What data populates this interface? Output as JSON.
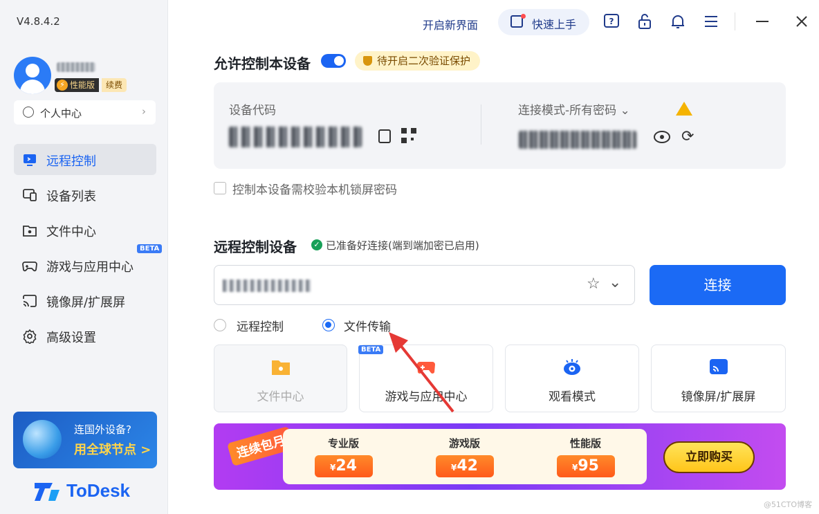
{
  "app": {
    "version": "V4.8.4.2",
    "brand": "ToDesk"
  },
  "user": {
    "tier_badge": "性能版",
    "renew_badge": "续费",
    "personal_center": "个人中心"
  },
  "sidebar": {
    "items": [
      {
        "label": "远程控制",
        "icon": "monitor-icon",
        "active": true
      },
      {
        "label": "设备列表",
        "icon": "devices-icon"
      },
      {
        "label": "文件中心",
        "icon": "folder-icon"
      },
      {
        "label": "游戏与应用中心",
        "icon": "gamepad-icon",
        "badge": "BETA"
      },
      {
        "label": "镜像屏/扩展屏",
        "icon": "cast-icon"
      },
      {
        "label": "高级设置",
        "icon": "gear-icon"
      }
    ],
    "promo": {
      "line1": "连国外设备?",
      "line2": "用全球节点 >"
    }
  },
  "topbar": {
    "new_ui": "开启新界面",
    "quick_start": "快速上手"
  },
  "allow": {
    "title": "允许控制本设备",
    "enabled": true,
    "warning": "待开启二次验证保护",
    "device_code_label": "设备代码",
    "mode_label": "连接模式-所有密码 ⌄",
    "lock_check_label": "控制本设备需校验本机锁屏密码"
  },
  "remote": {
    "title": "远程控制设备",
    "status": "已准备好连接(端到端加密已启用)",
    "connect_label": "连接",
    "modes": [
      {
        "label": "远程控制",
        "selected": false
      },
      {
        "label": "文件传输",
        "selected": true
      }
    ],
    "tiles": [
      {
        "label": "文件中心",
        "disabled": true
      },
      {
        "label": "游戏与应用中心",
        "badge": "BETA"
      },
      {
        "label": "观看模式"
      },
      {
        "label": "镜像屏/扩展屏"
      }
    ]
  },
  "banner": {
    "tag": "连续包月",
    "plans": [
      {
        "name": "专业版",
        "currency": "¥",
        "price": "24"
      },
      {
        "name": "游戏版",
        "currency": "¥",
        "price": "42"
      },
      {
        "name": "性能版",
        "currency": "¥",
        "price": "95"
      }
    ],
    "buy_label": "立即购买"
  },
  "watermark": "@51CTO博客",
  "colors": {
    "accent": "#1b6af5",
    "warning": "#f5b301",
    "success": "#18a058"
  }
}
